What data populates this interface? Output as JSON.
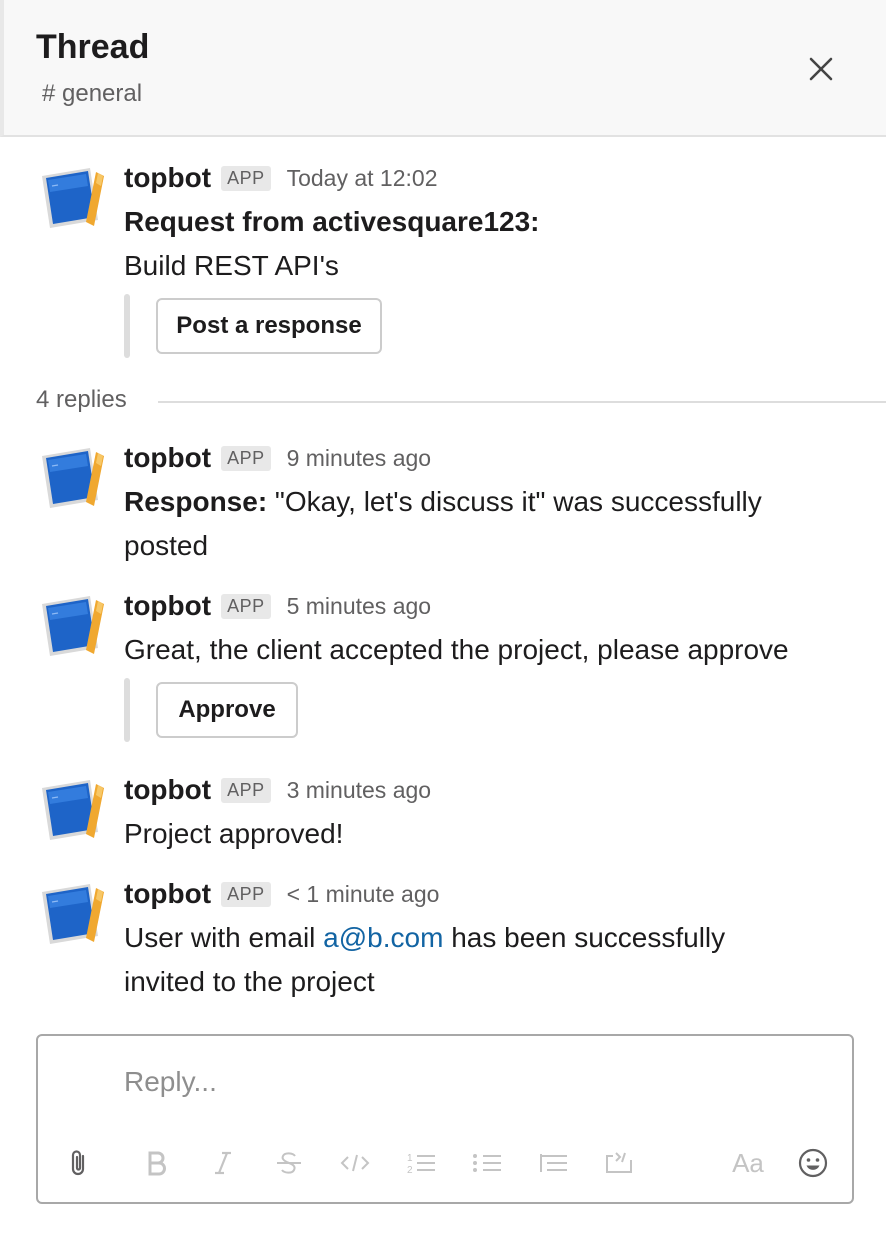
{
  "header": {
    "title": "Thread",
    "channel": "# general",
    "close_icon": "close-icon"
  },
  "parent": {
    "user": "topbot",
    "badge": "APP",
    "time": "Today at 12:02",
    "line1": "Request from activesquare123:",
    "line2": "Build REST API's",
    "button_label": "Post a response"
  },
  "replies": {
    "count_label": "4 replies",
    "items": [
      {
        "user": "topbot",
        "badge": "APP",
        "time": "9 minutes ago",
        "bold_prefix": "Response:",
        "text_line1": " \"Okay, let's discuss it\" was successfully",
        "text_line2": "posted"
      },
      {
        "user": "topbot",
        "badge": "APP",
        "time": "5 minutes ago",
        "text": "Great, the client accepted the project, please approve",
        "button_label": "Approve"
      },
      {
        "user": "topbot",
        "badge": "APP",
        "time": "3 minutes ago",
        "text": "Project approved!"
      },
      {
        "user": "topbot",
        "badge": "APP",
        "time": "< 1 minute ago",
        "text_before": "User with email ",
        "link": "a@b.com",
        "text_after": " has been successfully",
        "text_line2": "invited to the project"
      }
    ]
  },
  "composer": {
    "placeholder": "Reply...",
    "value": "",
    "tools": [
      "paperclip-icon",
      "bold-icon",
      "italic-icon",
      "strikethrough-icon",
      "code-icon",
      "numbered-list-icon",
      "bulleted-list-icon",
      "quote-icon",
      "code-block-icon",
      "text-format-icon",
      "emoji-icon"
    ],
    "format_label": "Aa"
  },
  "colors": {
    "link": "#1264a3",
    "avatar_blue": "#2a6fd6",
    "avatar_pencil": "#f0a830",
    "muted": "#616061"
  }
}
